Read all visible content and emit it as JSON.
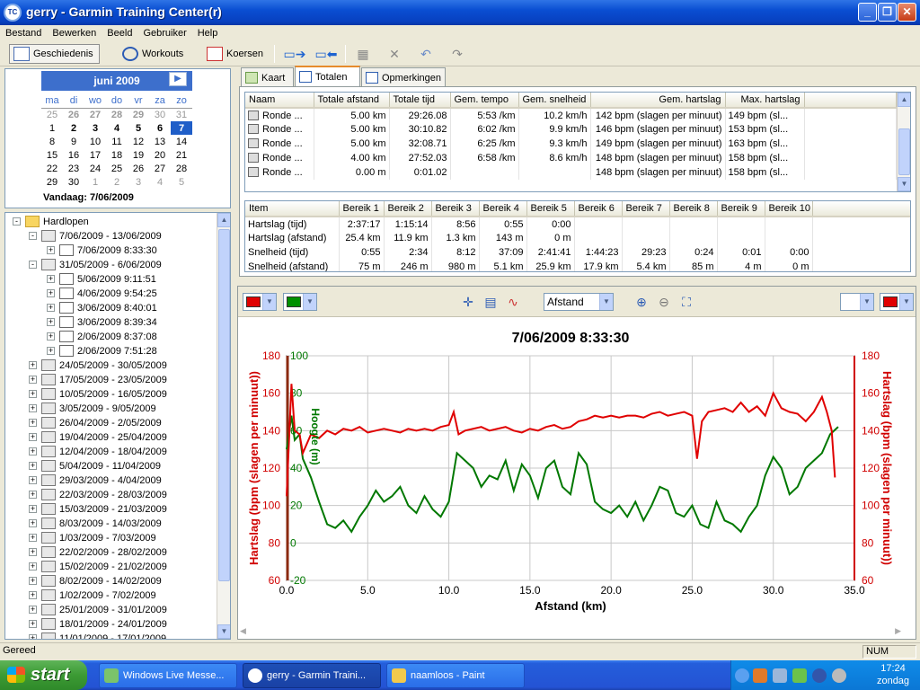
{
  "window": {
    "title": "gerry - Garmin Training Center(r)",
    "app_icon": "TC"
  },
  "menu": [
    "Bestand",
    "Bewerken",
    "Beeld",
    "Gebruiker",
    "Help"
  ],
  "toolbar": {
    "geschiedenis": "Geschiedenis",
    "workouts": "Workouts",
    "koersen": "Koersen"
  },
  "calendar": {
    "month": "juni 2009",
    "weekdays": [
      "ma",
      "di",
      "wo",
      "do",
      "vr",
      "za",
      "zo"
    ],
    "weeks": [
      [
        "25",
        "26",
        "27",
        "28",
        "29",
        "30",
        "31"
      ],
      [
        "1",
        "2",
        "3",
        "4",
        "5",
        "6",
        "7"
      ],
      [
        "8",
        "9",
        "10",
        "11",
        "12",
        "13",
        "14"
      ],
      [
        "15",
        "16",
        "17",
        "18",
        "19",
        "20",
        "21"
      ],
      [
        "22",
        "23",
        "24",
        "25",
        "26",
        "27",
        "28"
      ],
      [
        "29",
        "30",
        "1",
        "2",
        "3",
        "4",
        "5"
      ]
    ],
    "today_label": "Vandaag: 7/06/2009"
  },
  "tree": {
    "root": "Hardlopen",
    "week1": "7/06/2009 - 13/06/2009",
    "week1_items": [
      "7/06/2009 8:33:30"
    ],
    "week2": "31/05/2009 - 6/06/2009",
    "week2_items": [
      "5/06/2009 9:11:51",
      "4/06/2009 9:54:25",
      "3/06/2009 8:40:01",
      "3/06/2009 8:39:34",
      "2/06/2009 8:37:08",
      "2/06/2009 7:51:28"
    ],
    "weeks": [
      "24/05/2009 - 30/05/2009",
      "17/05/2009 - 23/05/2009",
      "10/05/2009 - 16/05/2009",
      "3/05/2009 - 9/05/2009",
      "26/04/2009 - 2/05/2009",
      "19/04/2009 - 25/04/2009",
      "12/04/2009 - 18/04/2009",
      "5/04/2009 - 11/04/2009",
      "29/03/2009 - 4/04/2009",
      "22/03/2009 - 28/03/2009",
      "15/03/2009 - 21/03/2009",
      "8/03/2009 - 14/03/2009",
      "1/03/2009 - 7/03/2009",
      "22/02/2009 - 28/02/2009",
      "15/02/2009 - 21/02/2009",
      "8/02/2009 - 14/02/2009",
      "1/02/2009 - 7/02/2009",
      "25/01/2009 - 31/01/2009",
      "18/01/2009 - 24/01/2009",
      "11/01/2009 - 17/01/2009"
    ]
  },
  "tabs": [
    "Kaart",
    "Totalen",
    "Opmerkingen"
  ],
  "laps": {
    "columns": [
      "Naam",
      "Totale afstand",
      "Totale tijd",
      "Gem. tempo",
      "Gem. snelheid",
      "Gem. hartslag",
      "Max. hartslag"
    ],
    "rows": [
      [
        "Ronde ...",
        "5.00 km",
        "29:26.08",
        "5:53 /km",
        "10.2 km/h",
        "142 bpm (slagen per minuut)",
        "149 bpm (sl..."
      ],
      [
        "Ronde ...",
        "5.00 km",
        "30:10.82",
        "6:02 /km",
        "9.9 km/h",
        "146 bpm (slagen per minuut)",
        "153 bpm (sl..."
      ],
      [
        "Ronde ...",
        "5.00 km",
        "32:08.71",
        "6:25 /km",
        "9.3 km/h",
        "149 bpm (slagen per minuut)",
        "163 bpm (sl..."
      ],
      [
        "Ronde ...",
        "4.00 km",
        "27:52.03",
        "6:58 /km",
        "8.6 km/h",
        "148 bpm (slagen per minuut)",
        "158 bpm (sl..."
      ],
      [
        "Ronde ...",
        "0.00 m",
        "0:01.02",
        "",
        "",
        "148 bpm (slagen per minuut)",
        "158 bpm (sl..."
      ]
    ]
  },
  "zones": {
    "columns": [
      "Item",
      "Bereik 1",
      "Bereik 2",
      "Bereik 3",
      "Bereik 4",
      "Bereik 5",
      "Bereik 6",
      "Bereik 7",
      "Bereik 8",
      "Bereik 9",
      "Bereik 10"
    ],
    "rows": [
      [
        "Hartslag (tijd)",
        "2:37:17",
        "1:15:14",
        "8:56",
        "0:55",
        "0:00",
        "",
        "",
        "",
        "",
        ""
      ],
      [
        "Hartslag (afstand)",
        "25.4 km",
        "11.9 km",
        "1.3 km",
        "143 m",
        "0 m",
        "",
        "",
        "",
        "",
        ""
      ],
      [
        "Snelheid (tijd)",
        "0:55",
        "2:34",
        "8:12",
        "37:09",
        "2:41:41",
        "1:44:23",
        "29:23",
        "0:24",
        "0:01",
        "0:00"
      ],
      [
        "Snelheid (afstand)",
        "75 m",
        "246 m",
        "980 m",
        "5.1 km",
        "25.9 km",
        "17.9 km",
        "5.4 km",
        "85 m",
        "4 m",
        "0 m"
      ]
    ]
  },
  "chart_controls": {
    "x_select": "Afstand",
    "color_left": "#e00000",
    "color_right": "#009000",
    "color_right2": "#e00000"
  },
  "chart_data": {
    "type": "line",
    "title": "7/06/2009 8:33:30",
    "xlabel": "Afstand (km)",
    "ylabel_left": "Hartslag (bpm (slagen per minuut))",
    "ylabel_right": "Hartslag (bpm (slagen per minuut))",
    "ylabel_alt": "Hoogte (m)",
    "xlim": [
      0,
      35
    ],
    "ylim": [
      60,
      180
    ],
    "alt_ylim": [
      -20,
      100
    ],
    "x_ticks": [
      "0.0",
      "5.0",
      "10.0",
      "15.0",
      "20.0",
      "25.0",
      "30.0",
      "35.0"
    ],
    "y_ticks": [
      "60",
      "80",
      "100",
      "120",
      "140",
      "160",
      "180"
    ],
    "alt_ticks": [
      "-20",
      "0",
      "20",
      "40",
      "60",
      "80",
      "100"
    ],
    "grid": true,
    "series": [
      {
        "name": "Hartslag",
        "color": "#e00000",
        "x": [
          0,
          0.3,
          0.5,
          0.8,
          1,
          1.5,
          2,
          2.5,
          3,
          3.5,
          4,
          4.5,
          5,
          5.5,
          6,
          6.5,
          7,
          7.5,
          8,
          8.5,
          9,
          9.5,
          10,
          10.3,
          10.6,
          11,
          11.5,
          12,
          12.5,
          13,
          13.5,
          14,
          14.5,
          15,
          15.5,
          16,
          16.5,
          17,
          17.5,
          18,
          18.5,
          19,
          19.5,
          20,
          20.5,
          21,
          21.5,
          22,
          22.5,
          23,
          23.5,
          24,
          24.5,
          25,
          25.3,
          25.6,
          26,
          26.5,
          27,
          27.5,
          28,
          28.5,
          29,
          29.5,
          30,
          30.5,
          31,
          31.5,
          32,
          32.5,
          33,
          33.3,
          33.6,
          33.8
        ],
        "values": [
          105,
          165,
          140,
          138,
          128,
          138,
          136,
          140,
          138,
          141,
          140,
          142,
          139,
          140,
          141,
          140,
          139,
          141,
          140,
          141,
          140,
          142,
          143,
          150,
          138,
          140,
          141,
          142,
          140,
          141,
          142,
          140,
          139,
          141,
          140,
          142,
          143,
          141,
          142,
          145,
          146,
          148,
          147,
          148,
          147,
          148,
          148,
          147,
          149,
          150,
          148,
          149,
          150,
          148,
          125,
          145,
          150,
          151,
          152,
          150,
          155,
          150,
          153,
          148,
          160,
          152,
          150,
          149,
          145,
          150,
          158,
          150,
          140,
          115
        ]
      },
      {
        "name": "Hoogte",
        "color": "#007800",
        "x": [
          0,
          0.3,
          0.5,
          0.8,
          1,
          1.5,
          2,
          2.5,
          3,
          3.5,
          4,
          4.5,
          5,
          5.5,
          6,
          6.5,
          7,
          7.5,
          8,
          8.5,
          9,
          9.5,
          10,
          10.5,
          11,
          11.5,
          12,
          12.5,
          13,
          13.5,
          14,
          14.5,
          15,
          15.5,
          16,
          16.5,
          17,
          17.5,
          18,
          18.5,
          19,
          19.5,
          20,
          20.5,
          21,
          21.5,
          22,
          22.5,
          23,
          23.5,
          24,
          24.5,
          25,
          25.5,
          26,
          26.5,
          27,
          27.5,
          28,
          28.5,
          29,
          29.5,
          30,
          30.5,
          31,
          31.5,
          32,
          32.5,
          33,
          33.5,
          34
        ],
        "values": [
          50,
          68,
          55,
          58,
          45,
          35,
          22,
          10,
          8,
          12,
          6,
          14,
          20,
          28,
          22,
          25,
          30,
          20,
          16,
          25,
          18,
          14,
          22,
          48,
          44,
          40,
          30,
          36,
          34,
          44,
          28,
          42,
          36,
          24,
          40,
          44,
          30,
          26,
          48,
          42,
          22,
          18,
          16,
          20,
          14,
          22,
          12,
          20,
          30,
          28,
          16,
          14,
          20,
          10,
          8,
          22,
          12,
          10,
          6,
          14,
          20,
          36,
          46,
          40,
          26,
          30,
          40,
          44,
          48,
          58,
          62
        ]
      }
    ]
  },
  "status": {
    "text": "Gereed",
    "num": "NUM"
  },
  "taskbar": {
    "start": "start",
    "items": [
      "Windows Live Messe...",
      "gerry - Garmin Traini...",
      "naamloos - Paint"
    ],
    "time": "17:24",
    "day": "zondag"
  }
}
